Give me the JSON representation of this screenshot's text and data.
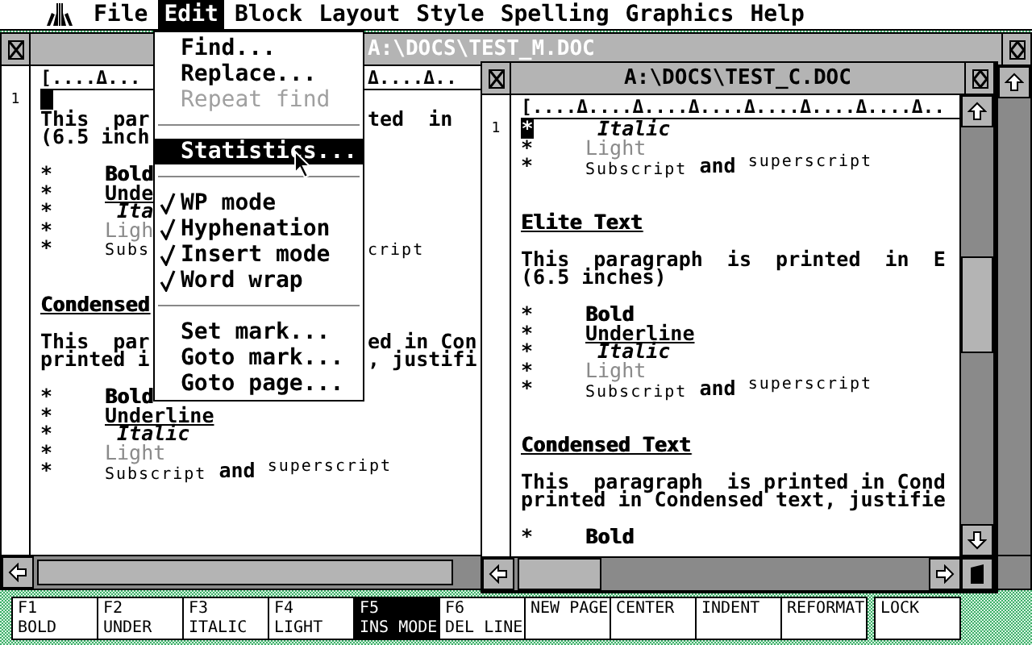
{
  "menubar": {
    "items": [
      {
        "label": "File",
        "selected": false
      },
      {
        "label": "Edit",
        "selected": true
      },
      {
        "label": "Block",
        "selected": false
      },
      {
        "label": "Layout",
        "selected": false
      },
      {
        "label": "Style",
        "selected": false
      },
      {
        "label": "Spelling",
        "selected": false
      },
      {
        "label": "Graphics",
        "selected": false
      },
      {
        "label": "Help",
        "selected": false
      }
    ]
  },
  "edit_menu": {
    "items": [
      {
        "kind": "item",
        "label": "Find...",
        "checked": false,
        "disabled": false,
        "selected": false
      },
      {
        "kind": "item",
        "label": "Replace...",
        "checked": false,
        "disabled": false,
        "selected": false
      },
      {
        "kind": "item",
        "label": "Repeat find",
        "checked": false,
        "disabled": true,
        "selected": false
      },
      {
        "kind": "separator"
      },
      {
        "kind": "item",
        "label": "Statistics...",
        "checked": false,
        "disabled": false,
        "selected": true
      },
      {
        "kind": "separator"
      },
      {
        "kind": "item",
        "label": "WP mode",
        "checked": true,
        "disabled": false,
        "selected": false
      },
      {
        "kind": "item",
        "label": "Hyphenation",
        "checked": true,
        "disabled": false,
        "selected": false
      },
      {
        "kind": "item",
        "label": "Insert mode",
        "checked": true,
        "disabled": false,
        "selected": false
      },
      {
        "kind": "item",
        "label": "Word wrap",
        "checked": true,
        "disabled": false,
        "selected": false
      },
      {
        "kind": "separator"
      },
      {
        "kind": "item",
        "label": "Set mark...",
        "checked": false,
        "disabled": false,
        "selected": false
      },
      {
        "kind": "item",
        "label": "Goto mark...",
        "checked": false,
        "disabled": false,
        "selected": false
      },
      {
        "kind": "item",
        "label": "Goto page...",
        "checked": false,
        "disabled": false,
        "selected": false
      }
    ]
  },
  "back_window": {
    "title": "A:\\DOCS\\TEST_M.DOC",
    "ruler": "[....Δ...",
    "ruler_after": "Δ....Δ..",
    "line_number": "1",
    "cursor": true,
    "lines": [
      {
        "kind": "blank"
      },
      {
        "kind": "plain",
        "text": "This  par",
        "after": "ted  in"
      },
      {
        "kind": "plain",
        "text": "(6.5 inch"
      },
      {
        "kind": "blank"
      },
      {
        "kind": "bold",
        "bullet": "*",
        "text": "Bold"
      },
      {
        "kind": "underline",
        "bullet": "*",
        "text": "Unde"
      },
      {
        "kind": "italic",
        "bullet": "*",
        "text": " Ita"
      },
      {
        "kind": "light",
        "bullet": "*",
        "text": "Ligh"
      },
      {
        "kind": "mixed",
        "bullet": "*",
        "text": "$_{Subs}$",
        "after": "$_{cript}$"
      },
      {
        "kind": "blank"
      },
      {
        "kind": "blank"
      },
      {
        "kind": "heading",
        "text": "Condensed"
      },
      {
        "kind": "blank"
      },
      {
        "kind": "plain",
        "text": "This  par",
        "after": "ed in Con"
      },
      {
        "kind": "plain",
        "text": "printed i",
        "after": ", justifi"
      },
      {
        "kind": "blank"
      },
      {
        "kind": "bold",
        "bullet": "*",
        "text": "Bold"
      },
      {
        "kind": "underline",
        "bullet": "*",
        "text": "Underline"
      },
      {
        "kind": "italic",
        "bullet": "*",
        "text": " Italic"
      },
      {
        "kind": "light",
        "bullet": "*",
        "text": "Light"
      },
      {
        "kind": "mixed",
        "bullet": "*",
        "text": "$_{Subscript}$ and $^{superscript}$"
      }
    ]
  },
  "front_window": {
    "title": "A:\\DOCS\\TEST_C.DOC",
    "ruler": "[....Δ....Δ....Δ....Δ....Δ....Δ....Δ..",
    "line_number": "1",
    "cursor": true,
    "lines": [
      {
        "kind": "italic",
        "bullet": "*",
        "text": " Italic"
      },
      {
        "kind": "light",
        "bullet": "*",
        "text": "Light"
      },
      {
        "kind": "mixed",
        "bullet": "*",
        "text": "$_{Subscript}$ and $^{superscript}$"
      },
      {
        "kind": "blank"
      },
      {
        "kind": "blank"
      },
      {
        "kind": "heading",
        "text": "Elite Text"
      },
      {
        "kind": "blank"
      },
      {
        "kind": "plain",
        "text": "This  paragraph  is  printed  in  E"
      },
      {
        "kind": "plain",
        "text": "(6.5 inches)"
      },
      {
        "kind": "blank"
      },
      {
        "kind": "bold",
        "bullet": "*",
        "text": "Bold"
      },
      {
        "kind": "underline",
        "bullet": "*",
        "text": "Underline"
      },
      {
        "kind": "italic",
        "bullet": "*",
        "text": " Italic"
      },
      {
        "kind": "light",
        "bullet": "*",
        "text": "Light"
      },
      {
        "kind": "mixed",
        "bullet": "*",
        "text": "$_{Subscript}$ and $^{superscript}$"
      },
      {
        "kind": "blank"
      },
      {
        "kind": "blank"
      },
      {
        "kind": "heading",
        "text": "Condensed Text"
      },
      {
        "kind": "blank"
      },
      {
        "kind": "plain",
        "text": "This  paragraph  is printed in Cond"
      },
      {
        "kind": "plain",
        "text": "printed in Condensed text, justifie"
      },
      {
        "kind": "blank"
      },
      {
        "kind": "bold",
        "bullet": "*",
        "text": "Bold"
      }
    ]
  },
  "function_keys": [
    {
      "key": "F1",
      "label": "BOLD",
      "selected": false
    },
    {
      "key": "F2",
      "label": "UNDER",
      "selected": false
    },
    {
      "key": "F3",
      "label": "ITALIC",
      "selected": false
    },
    {
      "key": "F4",
      "label": "LIGHT",
      "selected": false
    },
    {
      "key": "F5",
      "label": "INS MODE",
      "selected": true
    },
    {
      "key": "F6",
      "label": "DEL LINE",
      "selected": false
    },
    {
      "label": "NEW PAGE",
      "selected": false
    },
    {
      "label": "CENTER",
      "selected": false
    },
    {
      "label": "INDENT",
      "selected": false
    },
    {
      "label": "REFORMAT",
      "selected": false
    },
    {
      "label": "LOCK",
      "selected": false
    }
  ]
}
